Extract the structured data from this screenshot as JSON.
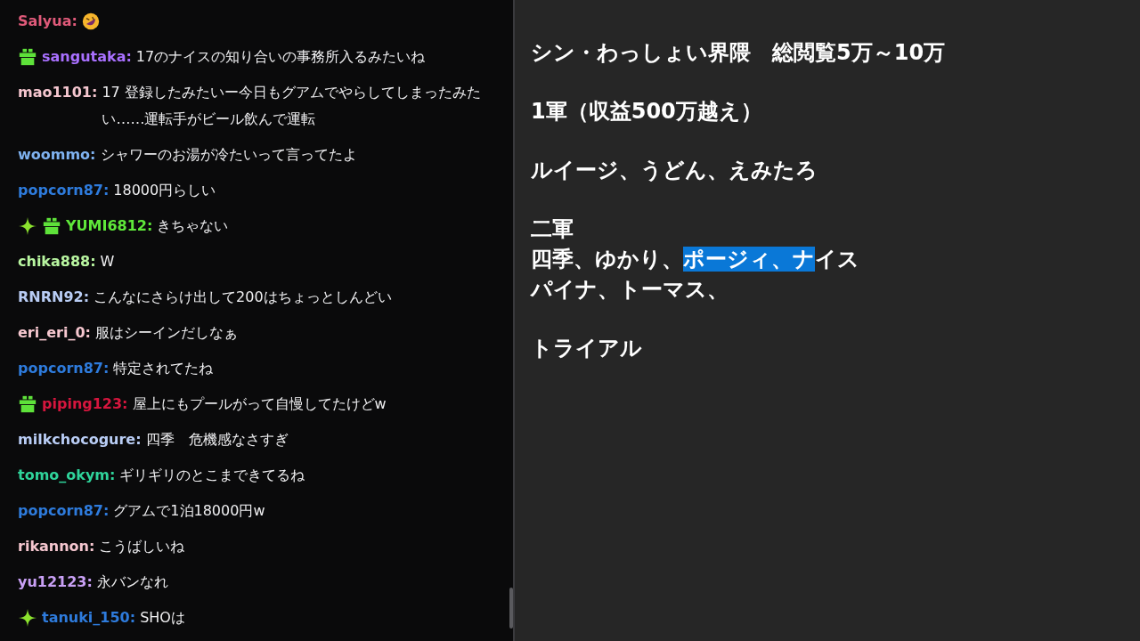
{
  "chat": {
    "messages": [
      {
        "user": "Salyua:",
        "color": "#e05a7a",
        "emotes": [
          {
            "kind": "rofl"
          }
        ]
      },
      {
        "user": "sangutaka:",
        "color": "#a970ff",
        "badges": [
          {
            "kind": "gift"
          }
        ],
        "text": "17のナイスの知り合いの事務所入るみたいね"
      },
      {
        "user": "mao1101:",
        "color": "#f5c6cf",
        "text": "17 登録したみたいー今日もグアムでやらしてしまったみたい……運転手がビール飲んで運転"
      },
      {
        "user": "woommo:",
        "color": "#7fb2f0",
        "text": "シャワーのお湯が冷たいって言ってたよ"
      },
      {
        "user": "popcorn87:",
        "color": "#2e7bdc",
        "text": "18000円らしい"
      },
      {
        "user": "YUMI6812:",
        "color": "#5fe83a",
        "badges": [
          {
            "kind": "sparkle"
          },
          {
            "kind": "gift"
          }
        ],
        "text": "きちゃない"
      },
      {
        "user": "chika888:",
        "color": "#b8f5a0",
        "text": "W"
      },
      {
        "user": "RNRN92:",
        "color": "#b9cdf5",
        "text": "こんなにさらけ出して200はちょっとしんどい"
      },
      {
        "user": "eri_eri_0:",
        "color": "#f7c8d0",
        "text": "服はシーインだしなぁ"
      },
      {
        "user": "popcorn87:",
        "color": "#2e7bdc",
        "text": "特定されてたね"
      },
      {
        "user": "piping123:",
        "color": "#d6163e",
        "badges": [
          {
            "kind": "gift"
          }
        ],
        "text": "屋上にもプールがって自慢してたけどw"
      },
      {
        "user": "milkchocogure:",
        "color": "#b9cdf5",
        "text": "四季　危機感なさすぎ"
      },
      {
        "user": "tomo_okym:",
        "color": "#2fd39a",
        "text": "ギリギリのとこまできてるね"
      },
      {
        "user": "popcorn87:",
        "color": "#2e7bdc",
        "text": "グアムで1泊18000円w"
      },
      {
        "user": "rikannon:",
        "color": "#f5c6cf",
        "text": "こうばしいね"
      },
      {
        "user": "yu12123:",
        "color": "#c9a0f5",
        "text": "永バンなれ"
      },
      {
        "user": "tanuki_150:",
        "color": "#2e7bdc",
        "badges": [
          {
            "kind": "sparkle"
          }
        ],
        "text": "SHOは"
      }
    ]
  },
  "document": {
    "blocks": [
      [
        [
          {
            "text": "シン・わっしょい界隈　総閲覧5万～10万",
            "selected": false
          }
        ]
      ],
      [
        [
          {
            "text": "1軍（収益500万越え）",
            "selected": false
          }
        ]
      ],
      [
        [
          {
            "text": "ルイージ、うどん、えみたろ",
            "selected": false
          }
        ]
      ],
      [
        [
          {
            "text": "二軍",
            "selected": false
          }
        ],
        [
          {
            "text": "四季、ゆかり、",
            "selected": false
          },
          {
            "text": "ポージィ、ナ",
            "selected": true
          },
          {
            "text": "イス",
            "selected": false
          }
        ],
        [
          {
            "text": "パイナ、トーマス、",
            "selected": false
          }
        ]
      ],
      [
        [
          {
            "text": "トライアル",
            "selected": false
          }
        ]
      ]
    ]
  }
}
